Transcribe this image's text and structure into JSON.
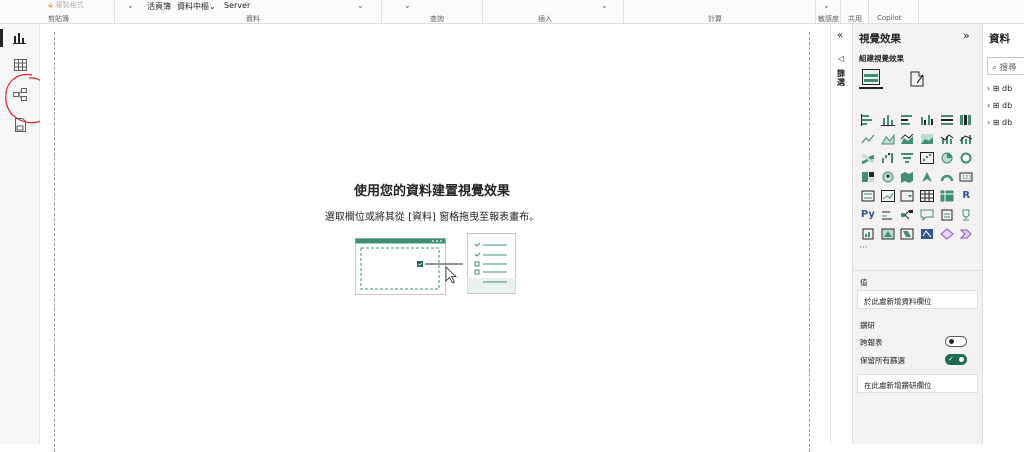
{
  "ribbon": {
    "format_painter": "複製格式",
    "clipboard_group": "剪貼簿",
    "workbook_label": "活頁簿",
    "onelake_label": "資料中樞",
    "server_label": "Server",
    "data_group": "資料",
    "query_group": "查詢",
    "insert_group": "插入",
    "calc_group": "計算",
    "sensitivity_group": "敏感度",
    "share_group": "共用",
    "copilot_group": "Copilot"
  },
  "left_rail": {
    "items": [
      "report-view",
      "table-view",
      "model-view",
      "dax-query-view"
    ]
  },
  "canvas": {
    "title": "使用您的資料建置視覺效果",
    "subtitle": "選取欄位或將其從 [資料] 窗格拖曳至報表畫布。"
  },
  "filters_pane": {
    "label": "篩選"
  },
  "viz_pane": {
    "title": "視覺效果",
    "subtitle": "組建視覺效果",
    "values_label": "值",
    "values_placeholder": "於此處新增資料欄位",
    "drill_label": "鑽研",
    "cross_report_label": "跨報表",
    "cross_report_state": "off",
    "keep_filters_label": "保留所有篩選",
    "keep_filters_state": "on",
    "drill_placeholder": "在此處新增鑽研欄位",
    "more_label": "···",
    "toggle_accent": "#1c6b52"
  },
  "data_pane": {
    "title": "資料",
    "search_placeholder": "搜尋",
    "tables": [
      "db",
      "db",
      "db"
    ]
  }
}
